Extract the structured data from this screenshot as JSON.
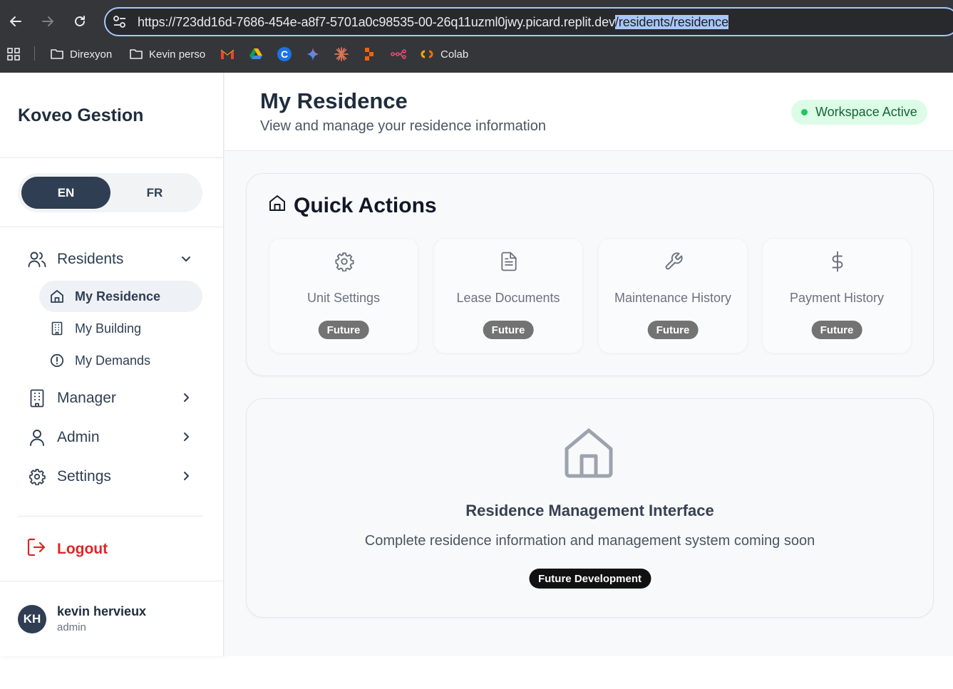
{
  "browser": {
    "url_prefix": "https://723dd16d-7686-454e-a8f7-5701a0c98535-00-26q11uzml0jwy.picard.replit.dev",
    "url_selected": "/residents/residence",
    "bookmarks": [
      {
        "label": "Direxyon",
        "icon": "folder-icon"
      },
      {
        "label": "Kevin perso",
        "icon": "folder-icon"
      },
      {
        "label": "Colab",
        "icon": "colab-icon"
      }
    ]
  },
  "sidebar": {
    "brand": "Koveo Gestion",
    "lang": {
      "en": "EN",
      "fr": "FR",
      "active": "EN"
    },
    "residents": {
      "label": "Residents",
      "items": [
        {
          "label": "My Residence",
          "icon": "home-icon",
          "active": true
        },
        {
          "label": "My Building",
          "icon": "building-icon"
        },
        {
          "label": "My Demands",
          "icon": "alert-circle-icon"
        }
      ]
    },
    "manager": {
      "label": "Manager"
    },
    "admin": {
      "label": "Admin"
    },
    "settings": {
      "label": "Settings"
    },
    "logout": "Logout",
    "user": {
      "initials": "KH",
      "name": "kevin hervieux",
      "role": "admin"
    }
  },
  "header": {
    "title": "My Residence",
    "subtitle": "View and manage your residence information",
    "status": "Workspace Active"
  },
  "quick_actions": {
    "title": "Quick Actions",
    "tiles": [
      {
        "label": "Unit Settings",
        "icon": "gear-icon",
        "badge": "Future"
      },
      {
        "label": "Lease Documents",
        "icon": "document-icon",
        "badge": "Future"
      },
      {
        "label": "Maintenance History",
        "icon": "wrench-icon",
        "badge": "Future"
      },
      {
        "label": "Payment History",
        "icon": "dollar-icon",
        "badge": "Future"
      }
    ]
  },
  "placeholder": {
    "title": "Residence Management Interface",
    "subtitle": "Complete residence information and management system coming soon",
    "badge": "Future Development"
  },
  "colors": {
    "brand_dark": "#2f3e52",
    "logout_red": "#dc2626",
    "active_green": "#22c55e"
  }
}
